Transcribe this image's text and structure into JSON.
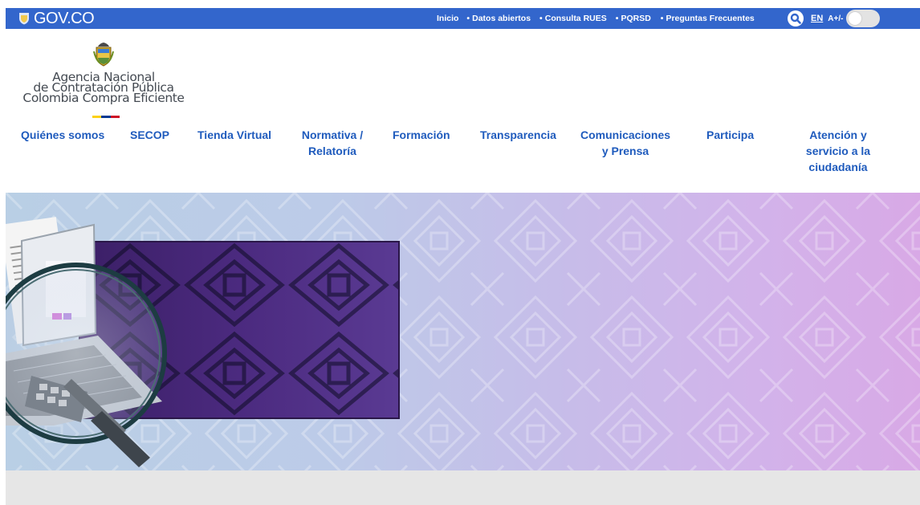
{
  "govbar": {
    "logo_text": "GOV.CO",
    "links": [
      "Inicio",
      "Datos abiertos",
      "Consulta RUES",
      "PQRSD",
      "Preguntas Frecuentes"
    ],
    "bullet": "•",
    "search_icon": "search-icon",
    "language": "EN",
    "font_size_label": "A+/-",
    "contrast_toggle": "toggle-off"
  },
  "entity": {
    "name_lines": [
      "Agencia Nacional",
      "de Contratación Pública",
      "Colombia Compra Eficiente"
    ],
    "flag_colors": [
      "#fcd116",
      "#003893",
      "#ce1126"
    ]
  },
  "nav": {
    "items": [
      {
        "line1": "Quiénes somos",
        "line2": "",
        "line3": ""
      },
      {
        "line1": "SECOP",
        "line2": "",
        "line3": ""
      },
      {
        "line1": "Tienda Virtual",
        "line2": "",
        "line3": ""
      },
      {
        "line1": "Normativa /",
        "line2": "Relatoría",
        "line3": ""
      },
      {
        "line1": "Formación",
        "line2": "",
        "line3": ""
      },
      {
        "line1": "Transparencia",
        "line2": "",
        "line3": ""
      },
      {
        "line1": "Comunicaciones",
        "line2": "y Prensa",
        "line3": ""
      },
      {
        "line1": "Participa",
        "line2": "",
        "line3": ""
      },
      {
        "line1": "Atención y",
        "line2": "servicio a la",
        "line3": "ciudadanía"
      }
    ]
  },
  "colors": {
    "govbar_bg": "#3366cc",
    "nav_text": "#1f5bbd",
    "footer_strip": "#e6e6e6"
  }
}
